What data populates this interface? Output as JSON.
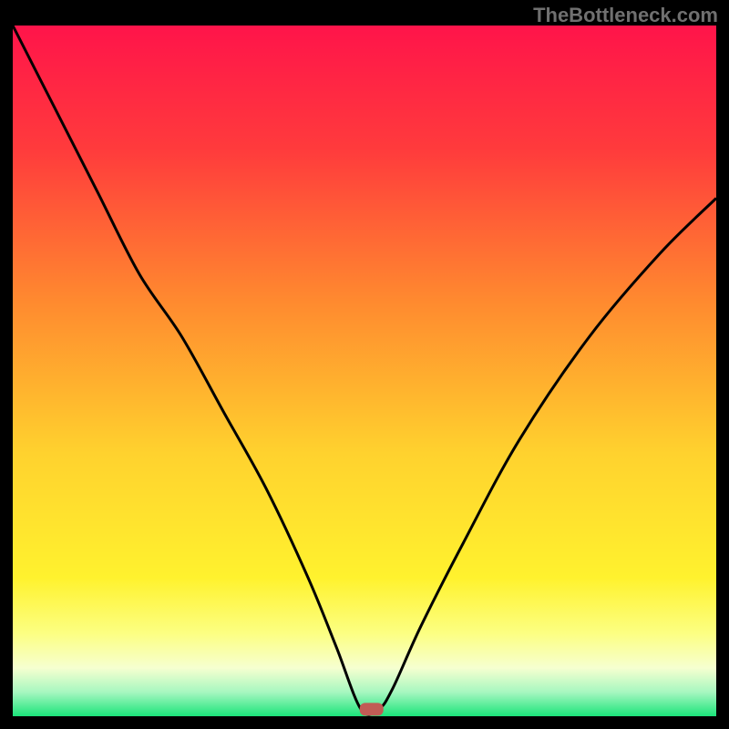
{
  "watermark": "TheBottleneck.com",
  "chart_data": {
    "type": "line",
    "title": "",
    "xlabel": "",
    "ylabel": "",
    "xlim": [
      0,
      100
    ],
    "ylim": [
      0,
      100
    ],
    "series": [
      {
        "name": "curve",
        "x": [
          0,
          6,
          12,
          18,
          24,
          30,
          36,
          42,
          46,
          49.5,
          52,
          54,
          58,
          64,
          72,
          82,
          92,
          100
        ],
        "y": [
          100,
          88,
          76,
          64,
          55,
          44,
          33,
          20,
          10,
          1,
          1,
          4,
          13,
          25,
          40,
          55,
          67,
          75
        ]
      }
    ],
    "marker": {
      "x": 51,
      "y": 1
    },
    "gradient_stops": [
      {
        "offset": 0,
        "color": "#ff144a"
      },
      {
        "offset": 0.18,
        "color": "#ff3b3c"
      },
      {
        "offset": 0.4,
        "color": "#ff8a2f"
      },
      {
        "offset": 0.62,
        "color": "#ffd22e"
      },
      {
        "offset": 0.8,
        "color": "#fff22e"
      },
      {
        "offset": 0.88,
        "color": "#fcff82"
      },
      {
        "offset": 0.93,
        "color": "#f6ffd0"
      },
      {
        "offset": 0.965,
        "color": "#a7f7c0"
      },
      {
        "offset": 1.0,
        "color": "#1be47a"
      }
    ]
  }
}
